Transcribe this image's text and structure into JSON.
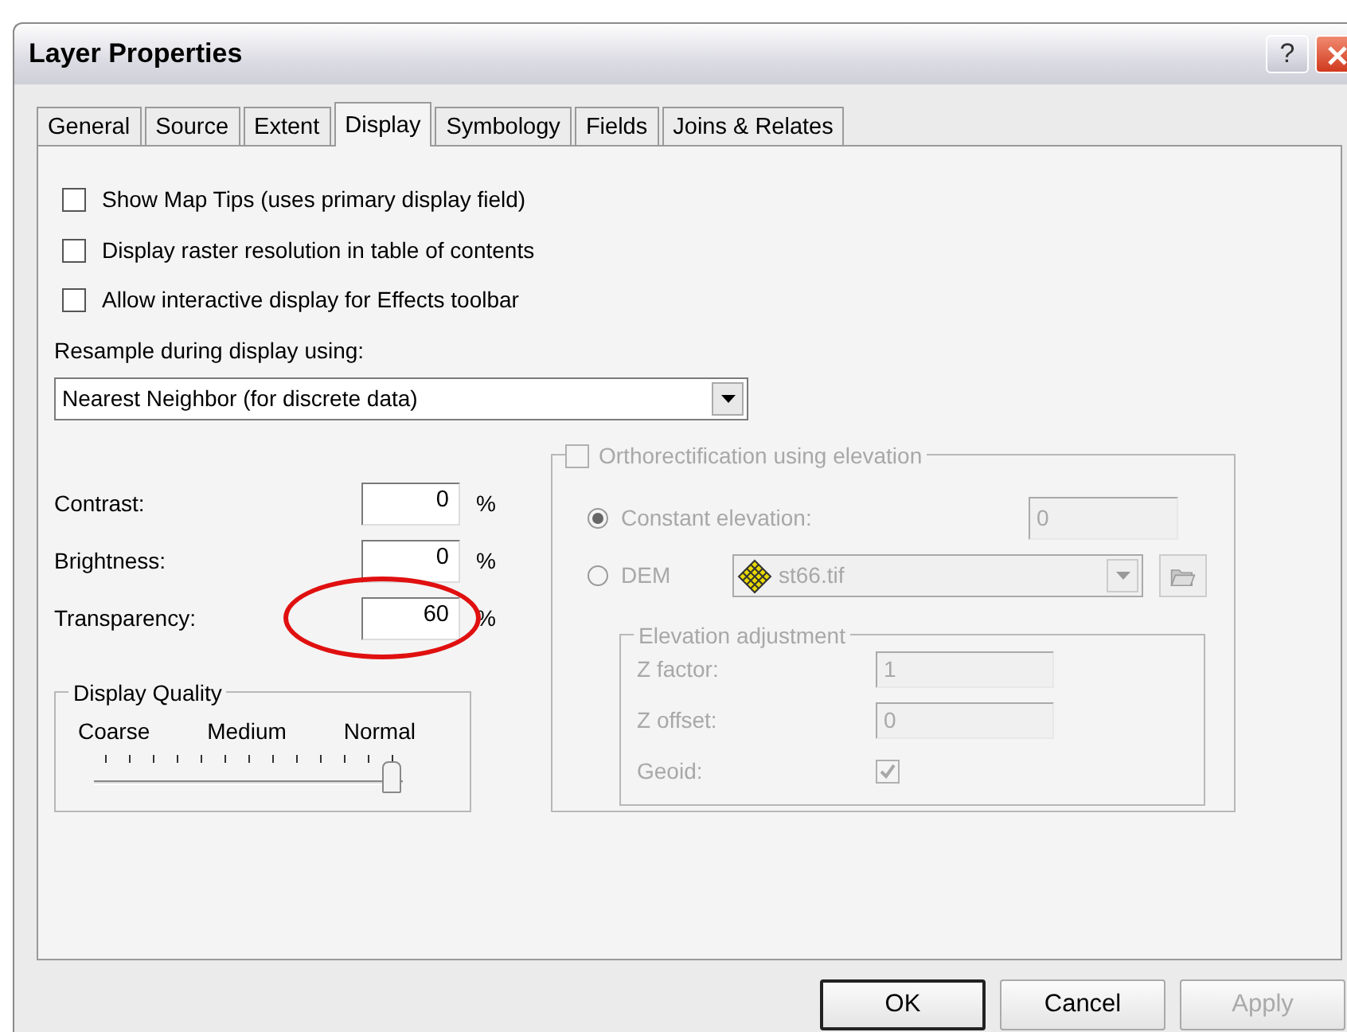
{
  "window": {
    "title": "Layer Properties",
    "help_button": "?"
  },
  "tabs": [
    {
      "label": "General",
      "selected": false
    },
    {
      "label": "Source",
      "selected": false
    },
    {
      "label": "Extent",
      "selected": false
    },
    {
      "label": "Display",
      "selected": true
    },
    {
      "label": "Symbology",
      "selected": false
    },
    {
      "label": "Fields",
      "selected": false
    },
    {
      "label": "Joins & Relates",
      "selected": false
    }
  ],
  "options": [
    {
      "label": "Show Map Tips (uses primary display field)",
      "checked": false
    },
    {
      "label": "Display raster resolution in table of contents",
      "checked": false
    },
    {
      "label": "Allow interactive display for Effects toolbar",
      "checked": false
    }
  ],
  "resample": {
    "label": "Resample during display using:",
    "value": "Nearest Neighbor (for discrete data)"
  },
  "adjustments": [
    {
      "label": "Contrast:",
      "value": "0",
      "unit": "%",
      "circled": false
    },
    {
      "label": "Brightness:",
      "value": "0",
      "unit": "%",
      "circled": false
    },
    {
      "label": "Transparency:",
      "value": "60",
      "unit": "%",
      "circled": true
    }
  ],
  "display_quality": {
    "title": "Display Quality",
    "marks": [
      "Coarse",
      "Medium",
      "Normal"
    ],
    "level": 1
  },
  "orthorectification": {
    "label": "Orthorectification using elevation",
    "checked": false,
    "disabled": true,
    "sources": [
      {
        "label": "Constant elevation:",
        "selected": true,
        "kind": "field",
        "value": "0"
      },
      {
        "label": "DEM",
        "selected": false,
        "kind": "dropdown",
        "value": "st66.tif"
      }
    ],
    "elevation_adjustment": {
      "title": "Elevation adjustment",
      "rows": [
        {
          "label": "Z factor:",
          "kind": "field",
          "value": "1"
        },
        {
          "label": "Z offset:",
          "kind": "field",
          "value": "0"
        },
        {
          "label": "Geoid:",
          "kind": "checkbox",
          "checked": true
        }
      ]
    }
  },
  "buttons": [
    {
      "label": "OK",
      "default": true,
      "disabled": false
    },
    {
      "label": "Cancel",
      "default": false,
      "disabled": false
    },
    {
      "label": "Apply",
      "default": false,
      "disabled": true
    }
  ]
}
